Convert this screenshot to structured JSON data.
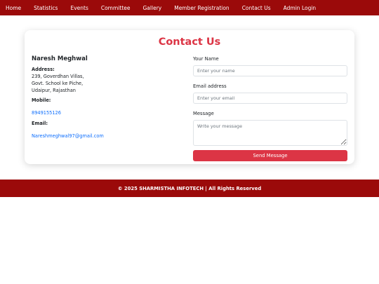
{
  "nav": {
    "items": [
      "Home",
      "Statistics",
      "Events",
      "Committee",
      "Gallery",
      "Member Registration",
      "Contact Us",
      "Admin Login"
    ]
  },
  "contact": {
    "title": "Contact Us",
    "name": "Naresh Meghwal",
    "address_label": "Address:",
    "address_lines": [
      "239, Goverdhan Villas,",
      "Govt. School ke Piche,",
      "Udaipur, Rajasthan"
    ],
    "mobile_label": "Mobile:",
    "mobile": "8949155126",
    "email_label": "Email:",
    "email": "Nareshmeghwal97@gmail.com"
  },
  "form": {
    "name_label": "Your Name",
    "name_placeholder": "Enter your name",
    "email_label": "Email address",
    "email_placeholder": "Enter your email",
    "message_label": "Message",
    "message_placeholder": "Write your message",
    "send_label": "Send Message"
  },
  "footer": {
    "text": "© 2025 SHARMISTHA INFOTECH | All Rights Reserved"
  },
  "colors": {
    "brand": "#9b0a0a",
    "accent": "#dc3545",
    "link": "#0d6efd"
  }
}
